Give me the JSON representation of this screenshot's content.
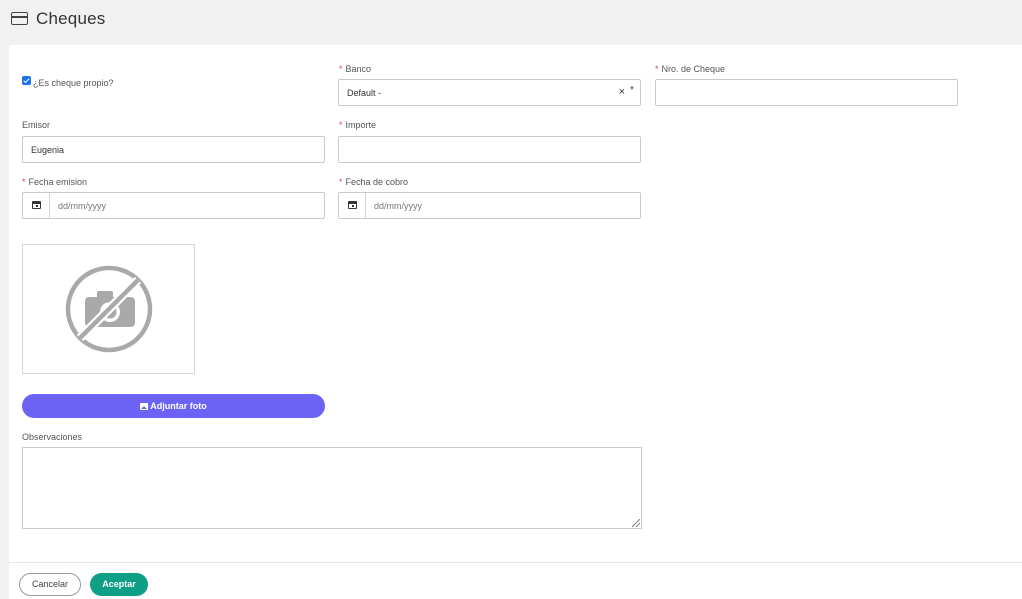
{
  "header": {
    "title": "Cheques",
    "icon": "credit-card-icon"
  },
  "form": {
    "own_check": {
      "label": "¿Es cheque propio?",
      "checked": true
    },
    "banco": {
      "label": "Banco",
      "required_mark": "*",
      "value": "Default -",
      "clear_glyph": "×"
    },
    "nro_cheque": {
      "label": "Nro. de Cheque",
      "required_mark": "*",
      "value": ""
    },
    "emisor": {
      "label": "Emisor",
      "value": "Eugenia"
    },
    "importe": {
      "label": "Importe",
      "required_mark": "*",
      "value": ""
    },
    "fecha_emision": {
      "label": "Fecha emision",
      "required_mark": "*",
      "placeholder": "dd/mm/yyyy"
    },
    "fecha_cobro": {
      "label": "Fecha de cobro",
      "required_mark": "*",
      "placeholder": "dd/mm/yyyy"
    },
    "attach_button": {
      "label": "Adjuntar foto"
    },
    "observaciones": {
      "label": "Observaciones",
      "value": ""
    }
  },
  "footer": {
    "cancel_label": "Cancelar",
    "accept_label": "Aceptar"
  },
  "colors": {
    "accent": "#6c63f6",
    "accept": "#0f9e86",
    "required": "#e0435c"
  }
}
